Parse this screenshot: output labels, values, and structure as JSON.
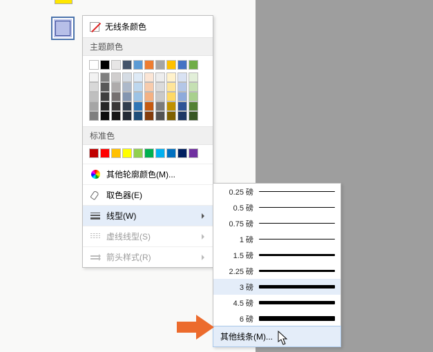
{
  "noColorLabel": "无线条颜色",
  "themeLabel": "主题颜色",
  "standardLabel": "标准色",
  "moreOutlineLabel": "其他轮廓颜色(M)...",
  "eyedropperLabel": "取色器(E)",
  "weightLabel": "线型(W)",
  "dashLabel": "虚线线型(S)",
  "arrowLabel": "箭头样式(R)",
  "moreLinesLabel": "其他线条(M)...",
  "weights": [
    {
      "label": "0.25 磅",
      "px": 0.5,
      "selected": false
    },
    {
      "label": "0.5 磅",
      "px": 1,
      "selected": false
    },
    {
      "label": "0.75 磅",
      "px": 1.2,
      "selected": false
    },
    {
      "label": "1 磅",
      "px": 1.6,
      "selected": false
    },
    {
      "label": "1.5 磅",
      "px": 2.2,
      "selected": false
    },
    {
      "label": "2.25 磅",
      "px": 3.2,
      "selected": false
    },
    {
      "label": "3 磅",
      "px": 4.2,
      "selected": true
    },
    {
      "label": "4.5 磅",
      "px": 5.8,
      "selected": false
    },
    {
      "label": "6 磅",
      "px": 7.6,
      "selected": false
    }
  ],
  "themeTopRow": [
    "#ffffff",
    "#000000",
    "#e7e6e6",
    "#44546a",
    "#5b9bd5",
    "#ed7d31",
    "#a5a5a5",
    "#ffc000",
    "#4472c4",
    "#70ad47"
  ],
  "themeTints": [
    [
      "#f2f2f2",
      "#7f7f7f",
      "#d0cece",
      "#d5dce4",
      "#deeaf6",
      "#fbe5d5",
      "#ededed",
      "#fff2cc",
      "#d9e2f3",
      "#e2efd9"
    ],
    [
      "#d8d8d8",
      "#595959",
      "#aeabab",
      "#adb9ca",
      "#bdd7ee",
      "#f7cbac",
      "#dbdbdb",
      "#fee599",
      "#b4c6e7",
      "#c5e0b3"
    ],
    [
      "#bfbfbf",
      "#3f3f3f",
      "#757070",
      "#8496b0",
      "#9cc3e5",
      "#f4b183",
      "#c9c9c9",
      "#ffd965",
      "#8eaadb",
      "#a8d08d"
    ],
    [
      "#a5a5a5",
      "#262626",
      "#3a3838",
      "#323f4f",
      "#2e75b5",
      "#c55a11",
      "#7b7b7b",
      "#bf9000",
      "#2f5496",
      "#538135"
    ],
    [
      "#7f7f7f",
      "#0c0c0c",
      "#171616",
      "#222a35",
      "#1e4e79",
      "#833c0b",
      "#525252",
      "#7f6000",
      "#1f3864",
      "#375623"
    ]
  ],
  "standardColors": [
    "#c00000",
    "#ff0000",
    "#ffc000",
    "#ffff00",
    "#92d050",
    "#00b050",
    "#00b0f0",
    "#0070c0",
    "#002060",
    "#7030a0"
  ],
  "arrowColor": "#ec6b2d"
}
